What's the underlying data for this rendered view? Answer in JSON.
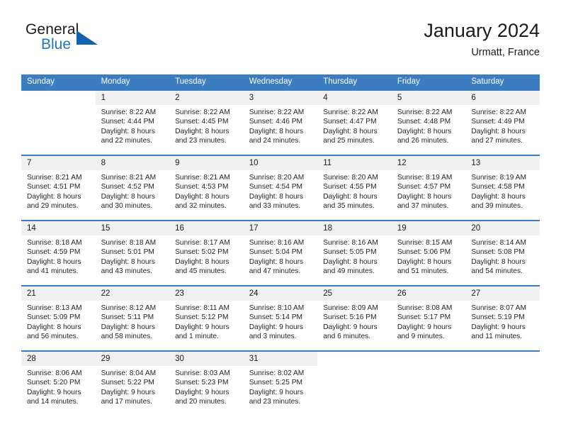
{
  "brand": {
    "word_one": "General",
    "word_two": "Blue",
    "triangle_icon": "triangle-icon",
    "accent_color": "#1163ad",
    "text_color": "#2176bd"
  },
  "header": {
    "title": "January 2024",
    "subtitle": "Urmatt, France"
  },
  "theme": {
    "header_row_bg": "#3c7cc0",
    "daynum_bg": "#f0f0f0",
    "rule_color": "#3c7cc0"
  },
  "weekday_headers": [
    "Sunday",
    "Monday",
    "Tuesday",
    "Wednesday",
    "Thursday",
    "Friday",
    "Saturday"
  ],
  "weeks": [
    [
      {
        "day": "",
        "lines": []
      },
      {
        "day": "1",
        "lines": [
          "Sunrise: 8:22 AM",
          "Sunset: 4:44 PM",
          "Daylight: 8 hours",
          "and 22 minutes."
        ]
      },
      {
        "day": "2",
        "lines": [
          "Sunrise: 8:22 AM",
          "Sunset: 4:45 PM",
          "Daylight: 8 hours",
          "and 23 minutes."
        ]
      },
      {
        "day": "3",
        "lines": [
          "Sunrise: 8:22 AM",
          "Sunset: 4:46 PM",
          "Daylight: 8 hours",
          "and 24 minutes."
        ]
      },
      {
        "day": "4",
        "lines": [
          "Sunrise: 8:22 AM",
          "Sunset: 4:47 PM",
          "Daylight: 8 hours",
          "and 25 minutes."
        ]
      },
      {
        "day": "5",
        "lines": [
          "Sunrise: 8:22 AM",
          "Sunset: 4:48 PM",
          "Daylight: 8 hours",
          "and 26 minutes."
        ]
      },
      {
        "day": "6",
        "lines": [
          "Sunrise: 8:22 AM",
          "Sunset: 4:49 PM",
          "Daylight: 8 hours",
          "and 27 minutes."
        ]
      }
    ],
    [
      {
        "day": "7",
        "lines": [
          "Sunrise: 8:21 AM",
          "Sunset: 4:51 PM",
          "Daylight: 8 hours",
          "and 29 minutes."
        ]
      },
      {
        "day": "8",
        "lines": [
          "Sunrise: 8:21 AM",
          "Sunset: 4:52 PM",
          "Daylight: 8 hours",
          "and 30 minutes."
        ]
      },
      {
        "day": "9",
        "lines": [
          "Sunrise: 8:21 AM",
          "Sunset: 4:53 PM",
          "Daylight: 8 hours",
          "and 32 minutes."
        ]
      },
      {
        "day": "10",
        "lines": [
          "Sunrise: 8:20 AM",
          "Sunset: 4:54 PM",
          "Daylight: 8 hours",
          "and 33 minutes."
        ]
      },
      {
        "day": "11",
        "lines": [
          "Sunrise: 8:20 AM",
          "Sunset: 4:55 PM",
          "Daylight: 8 hours",
          "and 35 minutes."
        ]
      },
      {
        "day": "12",
        "lines": [
          "Sunrise: 8:19 AM",
          "Sunset: 4:57 PM",
          "Daylight: 8 hours",
          "and 37 minutes."
        ]
      },
      {
        "day": "13",
        "lines": [
          "Sunrise: 8:19 AM",
          "Sunset: 4:58 PM",
          "Daylight: 8 hours",
          "and 39 minutes."
        ]
      }
    ],
    [
      {
        "day": "14",
        "lines": [
          "Sunrise: 8:18 AM",
          "Sunset: 4:59 PM",
          "Daylight: 8 hours",
          "and 41 minutes."
        ]
      },
      {
        "day": "15",
        "lines": [
          "Sunrise: 8:18 AM",
          "Sunset: 5:01 PM",
          "Daylight: 8 hours",
          "and 43 minutes."
        ]
      },
      {
        "day": "16",
        "lines": [
          "Sunrise: 8:17 AM",
          "Sunset: 5:02 PM",
          "Daylight: 8 hours",
          "and 45 minutes."
        ]
      },
      {
        "day": "17",
        "lines": [
          "Sunrise: 8:16 AM",
          "Sunset: 5:04 PM",
          "Daylight: 8 hours",
          "and 47 minutes."
        ]
      },
      {
        "day": "18",
        "lines": [
          "Sunrise: 8:16 AM",
          "Sunset: 5:05 PM",
          "Daylight: 8 hours",
          "and 49 minutes."
        ]
      },
      {
        "day": "19",
        "lines": [
          "Sunrise: 8:15 AM",
          "Sunset: 5:06 PM",
          "Daylight: 8 hours",
          "and 51 minutes."
        ]
      },
      {
        "day": "20",
        "lines": [
          "Sunrise: 8:14 AM",
          "Sunset: 5:08 PM",
          "Daylight: 8 hours",
          "and 54 minutes."
        ]
      }
    ],
    [
      {
        "day": "21",
        "lines": [
          "Sunrise: 8:13 AM",
          "Sunset: 5:09 PM",
          "Daylight: 8 hours",
          "and 56 minutes."
        ]
      },
      {
        "day": "22",
        "lines": [
          "Sunrise: 8:12 AM",
          "Sunset: 5:11 PM",
          "Daylight: 8 hours",
          "and 58 minutes."
        ]
      },
      {
        "day": "23",
        "lines": [
          "Sunrise: 8:11 AM",
          "Sunset: 5:12 PM",
          "Daylight: 9 hours",
          "and 1 minute."
        ]
      },
      {
        "day": "24",
        "lines": [
          "Sunrise: 8:10 AM",
          "Sunset: 5:14 PM",
          "Daylight: 9 hours",
          "and 3 minutes."
        ]
      },
      {
        "day": "25",
        "lines": [
          "Sunrise: 8:09 AM",
          "Sunset: 5:16 PM",
          "Daylight: 9 hours",
          "and 6 minutes."
        ]
      },
      {
        "day": "26",
        "lines": [
          "Sunrise: 8:08 AM",
          "Sunset: 5:17 PM",
          "Daylight: 9 hours",
          "and 9 minutes."
        ]
      },
      {
        "day": "27",
        "lines": [
          "Sunrise: 8:07 AM",
          "Sunset: 5:19 PM",
          "Daylight: 9 hours",
          "and 11 minutes."
        ]
      }
    ],
    [
      {
        "day": "28",
        "lines": [
          "Sunrise: 8:06 AM",
          "Sunset: 5:20 PM",
          "Daylight: 9 hours",
          "and 14 minutes."
        ]
      },
      {
        "day": "29",
        "lines": [
          "Sunrise: 8:04 AM",
          "Sunset: 5:22 PM",
          "Daylight: 9 hours",
          "and 17 minutes."
        ]
      },
      {
        "day": "30",
        "lines": [
          "Sunrise: 8:03 AM",
          "Sunset: 5:23 PM",
          "Daylight: 9 hours",
          "and 20 minutes."
        ]
      },
      {
        "day": "31",
        "lines": [
          "Sunrise: 8:02 AM",
          "Sunset: 5:25 PM",
          "Daylight: 9 hours",
          "and 23 minutes."
        ]
      },
      {
        "day": "",
        "lines": []
      },
      {
        "day": "",
        "lines": []
      },
      {
        "day": "",
        "lines": []
      }
    ]
  ]
}
